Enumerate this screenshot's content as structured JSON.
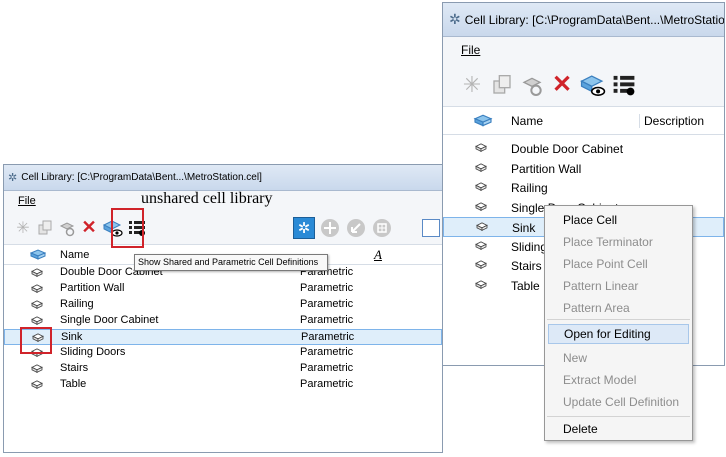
{
  "annotation": "unshared cell library",
  "left": {
    "title": "Cell Library: [C:\\ProgramData\\Bent...\\MetroStation.cel]",
    "menu": "File",
    "tooltip": "Show Shared and Parametric Cell Definitions",
    "columns": {
      "name": "Name",
      "type_icon_label": "A"
    },
    "rows": [
      {
        "name": "Double Door Cabinet",
        "type": "Parametric"
      },
      {
        "name": "Partition Wall",
        "type": "Parametric"
      },
      {
        "name": "Railing",
        "type": "Parametric"
      },
      {
        "name": "Single Door Cabinet",
        "type": "Parametric"
      },
      {
        "name": "Sink",
        "type": "Parametric"
      },
      {
        "name": "Sliding Doors",
        "type": "Parametric"
      },
      {
        "name": "Stairs",
        "type": "Parametric"
      },
      {
        "name": "Table",
        "type": "Parametric"
      }
    ],
    "selected": "Sink"
  },
  "right": {
    "title": "Cell Library: [C:\\ProgramData\\Bent...\\MetroStation",
    "menu": "File",
    "columns": {
      "name": "Name",
      "description": "Description"
    },
    "rows": [
      "Double Door Cabinet",
      "Partition Wall",
      "Railing",
      "Single Door Cabinet",
      "Sink",
      "Sliding",
      "Stairs",
      "Table"
    ],
    "selected": "Sink"
  },
  "context_menu": {
    "items": [
      {
        "label": "Place Cell",
        "enabled": true
      },
      {
        "label": "Place Terminator",
        "enabled": false
      },
      {
        "label": "Place Point Cell",
        "enabled": false
      },
      {
        "label": "Pattern Linear",
        "enabled": false
      },
      {
        "label": "Pattern Area",
        "enabled": false
      },
      {
        "label": "Open for Editing",
        "enabled": true,
        "highlighted": true
      },
      {
        "label": "New",
        "enabled": false
      },
      {
        "label": "Extract Model",
        "enabled": false
      },
      {
        "label": "Update Cell Definition",
        "enabled": false
      },
      {
        "label": "Delete",
        "enabled": true
      }
    ]
  },
  "colors": {
    "highlight": "#dfeefa",
    "accent_blue": "#2a8ad6",
    "delete_red": "#d0232a",
    "annotation_red": "#d0232a"
  }
}
